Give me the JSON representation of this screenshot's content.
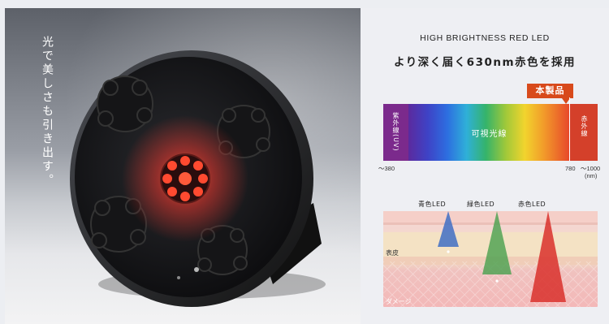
{
  "product_panel": {
    "tagline": "光で美しさも引き出す。"
  },
  "info_panel": {
    "subtitle": "HIGH BRIGHTNESS RED LED",
    "title": "より深く届く630nm赤色を採用",
    "product_badge": "本製品",
    "spectrum": {
      "uv_label": "紫外線(UV)",
      "visible_label": "可視光線",
      "ir_label": "赤外線",
      "tick_left": "〜380",
      "tick_mid": "780",
      "tick_right": "〜1000",
      "tick_unit": "(nm)"
    },
    "skin_diagram": {
      "blue_led": "青色LED",
      "green_led": "緑色LED",
      "red_led": "赤色LED",
      "epidermis_label": "表皮",
      "damage_label": "ダメージ"
    }
  },
  "colors": {
    "accent_orange": "#d84a1b",
    "led_red": "#e8352c",
    "uv_purple": "#7b2a8c",
    "ir_red": "#d4402a",
    "blue_beam": "#3f6fc4",
    "green_beam": "#49a04d",
    "red_beam": "#d9302c"
  }
}
